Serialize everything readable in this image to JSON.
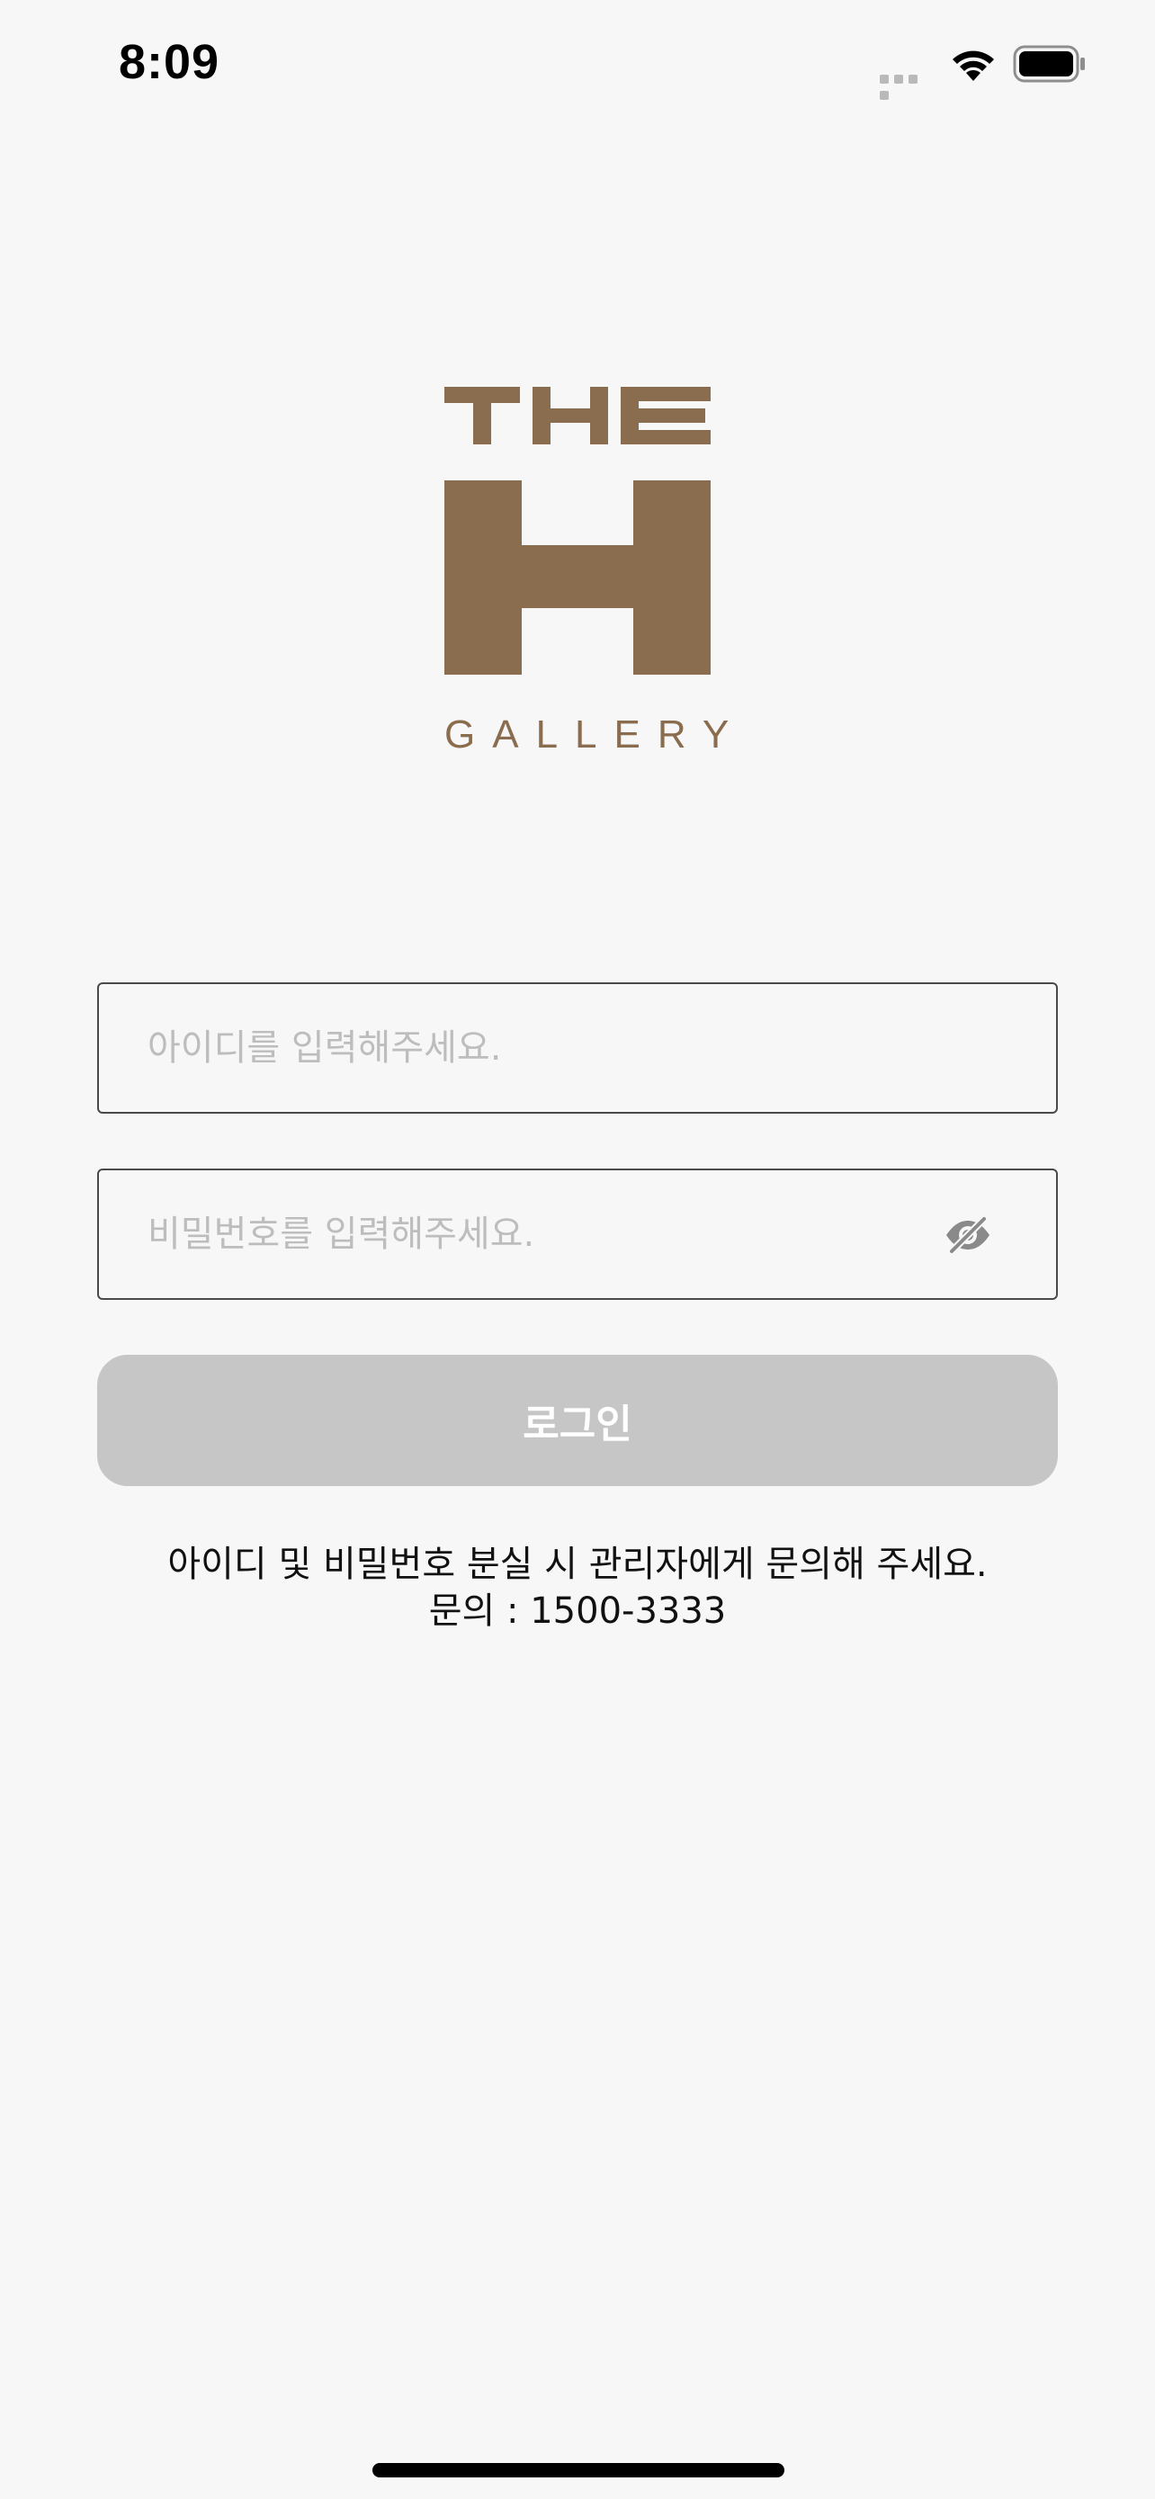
{
  "status_bar": {
    "time": "8:09"
  },
  "logo": {
    "wordmark_top": "THE",
    "wordmark_letter": "H",
    "wordmark_bottom": "GALLERY",
    "brand_color": "#8a6d4f"
  },
  "login_form": {
    "id_placeholder": "아이디를 입력해주세요.",
    "id_value": "",
    "password_placeholder": "비밀번호를 입력해주세요.",
    "password_value": "",
    "password_toggle_icon": "eye-slash-icon",
    "login_label": "로그인",
    "login_button_color": "#c6c6c6"
  },
  "help": {
    "line1": "아이디 및 비밀번호 분실 시 관리자에게 문의해 주세요.",
    "line2": "문의 : 1500-3333"
  }
}
